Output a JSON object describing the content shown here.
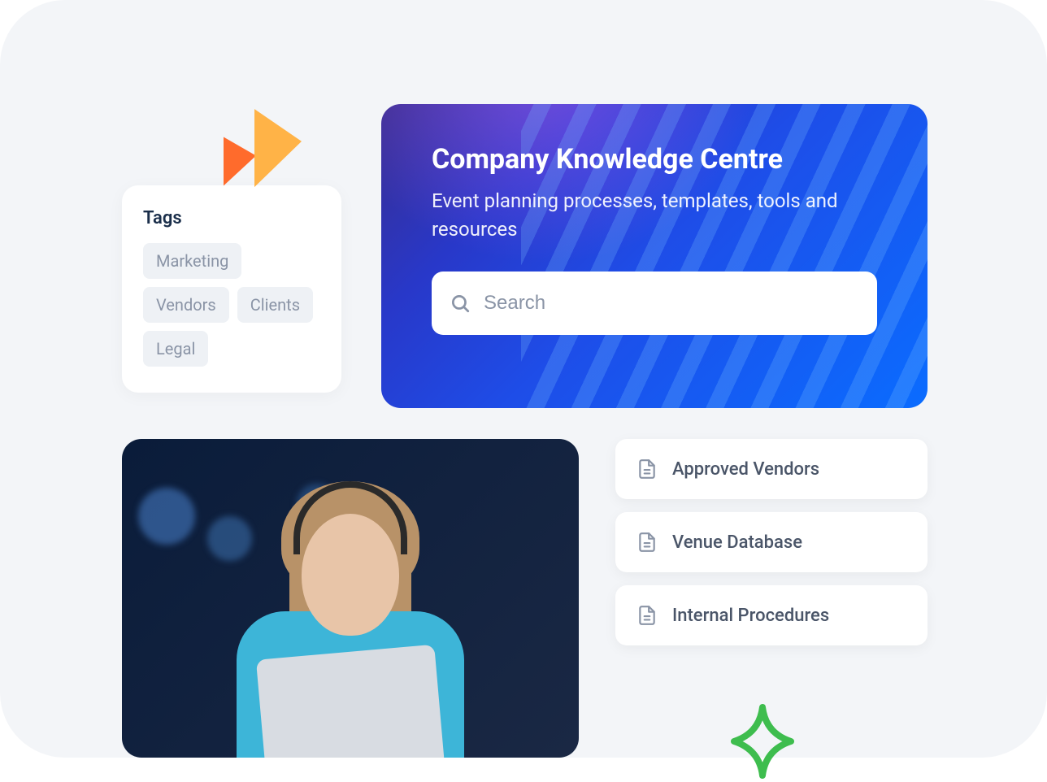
{
  "tags_panel": {
    "title": "Tags",
    "items": [
      "Marketing",
      "Vendors",
      "Clients",
      "Legal"
    ]
  },
  "hero": {
    "title": "Company Knowledge Centre",
    "subtitle": "Event planning processes, templates, tools and resources",
    "search_placeholder": "Search"
  },
  "resources": [
    {
      "label": "Approved Vendors"
    },
    {
      "label": "Venue Database"
    },
    {
      "label": "Internal Procedures"
    }
  ]
}
